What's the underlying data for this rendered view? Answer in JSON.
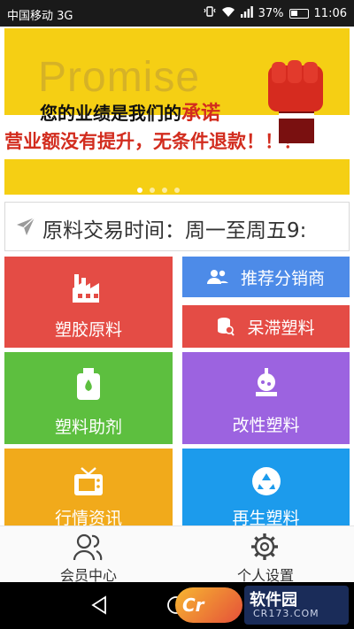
{
  "status_bar": {
    "carrier": "中国移动 3G",
    "battery": "37%",
    "time": "11:06"
  },
  "banner": {
    "watermark": "Promise",
    "headline": "您的业绩是我们的",
    "headline_accent": "承诺",
    "slogan": "营业额没有提升，无条件退款！！！",
    "dot_count": 4,
    "active_dot": 0
  },
  "notice": {
    "text": "原料交易时间：周一至周五9:"
  },
  "tiles": {
    "plastic_raw": "塑胶原料",
    "recommend_dist": "推荐分销商",
    "slow_plastic": "呆滞塑料",
    "additive": "塑料助剂",
    "modified": "改性塑料",
    "market_info": "行情资讯",
    "recycled": "再生塑料"
  },
  "tabbar": {
    "member": "会员中心",
    "settings": "个人设置"
  },
  "watermark_brand": {
    "name": "软件园",
    "domain": "CR173.COM"
  },
  "colors": {
    "red": "#e44c45",
    "blue": "#4d8be8",
    "green": "#5dbf3f",
    "purple": "#9c63e0",
    "orange": "#f1aa1b",
    "azure": "#1c9bec",
    "banner_yellow": "#f5cf14"
  }
}
